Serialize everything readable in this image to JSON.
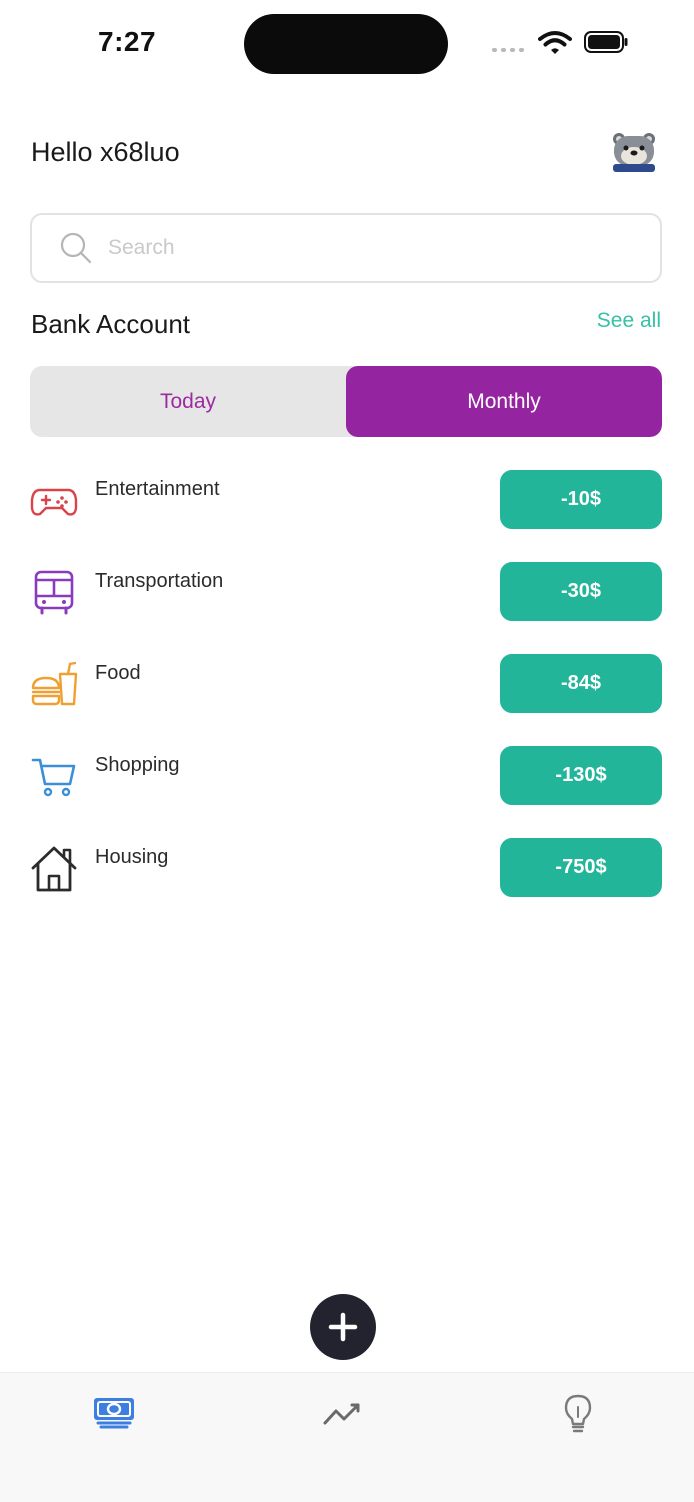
{
  "status_bar": {
    "time": "7:27"
  },
  "header": {
    "greeting": "Hello x68luo",
    "avatar_icon": "bear-avatar-icon"
  },
  "search": {
    "placeholder": "Search"
  },
  "section": {
    "title": "Bank Account",
    "see_all": "See all"
  },
  "toggle": {
    "options": [
      "Today",
      "Monthly"
    ],
    "selected": "Monthly"
  },
  "colors": {
    "accent_purple": "#9524a0",
    "amount_green": "#23b59a",
    "link_teal": "#38c0a5"
  },
  "categories": [
    {
      "label": "Entertainment",
      "amount": "-10$",
      "icon": "gamepad-icon"
    },
    {
      "label": "Transportation",
      "amount": "-30$",
      "icon": "bus-icon"
    },
    {
      "label": "Food",
      "amount": "-84$",
      "icon": "burger-drink-icon"
    },
    {
      "label": "Shopping",
      "amount": "-130$",
      "icon": "shopping-cart-icon"
    },
    {
      "label": "Housing",
      "amount": "-750$",
      "icon": "house-icon"
    }
  ],
  "tabs": [
    {
      "icon": "money-icon",
      "active": true
    },
    {
      "icon": "trend-chart-icon",
      "active": false
    },
    {
      "icon": "lightbulb-icon",
      "active": false
    }
  ]
}
